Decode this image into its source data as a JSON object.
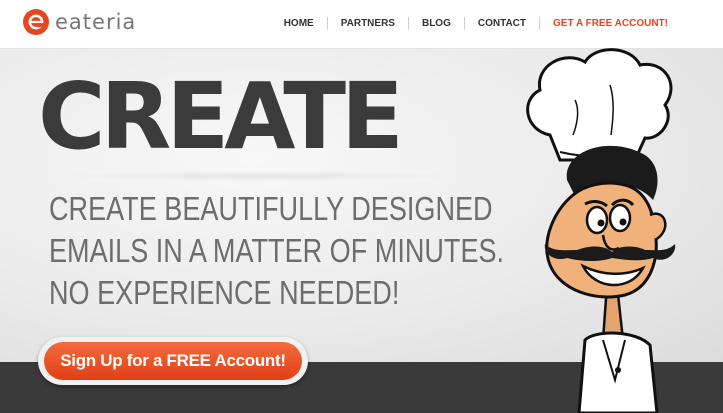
{
  "brand": {
    "name": "eateria",
    "accent_color": "#e6461f"
  },
  "nav": {
    "items": [
      "HOME",
      "PARTNERS",
      "BLOG",
      "CONTACT"
    ],
    "cta": "GET A FREE ACCOUNT!"
  },
  "hero": {
    "title": "CREATE",
    "lines": [
      "CREATE BEAUTIFULLY DESIGNED",
      "EMAILS IN A MATTER OF MINUTES.",
      "NO EXPERIENCE NEEDED!"
    ],
    "signup_label": "Sign Up for a FREE Account!",
    "illustration": "chef-mascot"
  }
}
